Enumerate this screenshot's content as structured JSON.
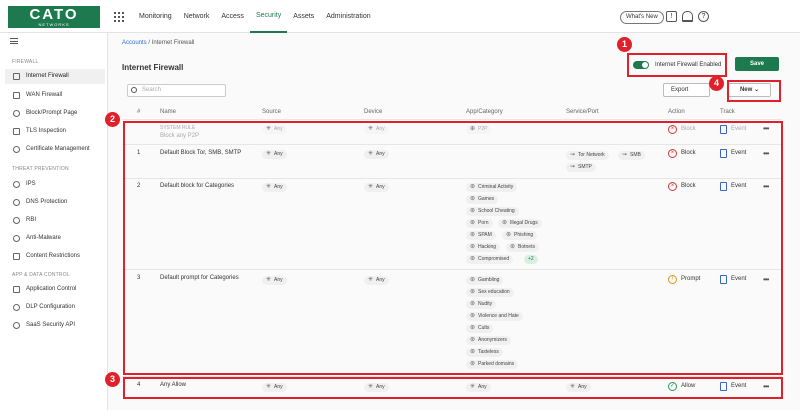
{
  "brand": {
    "name": "CATO",
    "sub": "NETWORKS"
  },
  "nav": [
    "Monitoring",
    "Network",
    "Access",
    "Security",
    "Assets",
    "Administration"
  ],
  "nav_active": "Security",
  "header": {
    "whats_new": "What's New"
  },
  "sidebar": {
    "sections": [
      {
        "label": "FIREWALL",
        "items": [
          "Internet Firewall",
          "WAN Firewall",
          "Block/Prompt Page",
          "TLS Inspection",
          "Certificate Management"
        ]
      },
      {
        "label": "THREAT PREVENTION",
        "items": [
          "IPS",
          "DNS Protection",
          "RBI",
          "Anti-Malware",
          "Content Restrictions"
        ]
      },
      {
        "label": "APP & DATA CONTROL",
        "items": [
          "Application Control",
          "DLP Configuration",
          "SaaS Security API"
        ]
      }
    ]
  },
  "breadcrumb": {
    "parent": "Accounts",
    "sep": "/",
    "current": "Internet Firewall"
  },
  "page_title": "Internet Firewall",
  "toggle_label": "Internet Firewall Enabled",
  "save_label": "Save",
  "search_placeholder": "Search",
  "export_label": "Export",
  "new_label": "New",
  "columns": [
    "#",
    "Name",
    "Source",
    "Device",
    "App/Category",
    "Service/Port",
    "Action",
    "Track"
  ],
  "rules": [
    {
      "num": "",
      "name": "SYSTEM RULE",
      "name2": "Block any P2P",
      "source": "Any",
      "device": "Any",
      "apps": [
        "P2P"
      ],
      "services": [],
      "action": "Block",
      "track": "Event"
    },
    {
      "num": "1",
      "name": "Default Block Tor, SMB, SMTP",
      "source": "Any",
      "device": "Any",
      "apps": [],
      "services": [
        "Tor Network",
        "SMB",
        "SMTP"
      ],
      "action": "Block",
      "track": "Event"
    },
    {
      "num": "2",
      "name": "Default block for Categories",
      "source": "Any",
      "device": "Any",
      "apps": [
        "Criminal Activity",
        "Games",
        "School Cheating",
        "Porn",
        "Illegal Drugs",
        "SPAM",
        "Phishing",
        "Hacking",
        "Botnets",
        "Compromised"
      ],
      "more": "+2",
      "services": [],
      "action": "Block",
      "track": "Event"
    },
    {
      "num": "3",
      "name": "Default prompt for Categories",
      "source": "Any",
      "device": "Any",
      "apps": [
        "Gambling",
        "Sex education",
        "Nudity",
        "Violence and Hate",
        "Cults",
        "Anonymizers",
        "Tasteless",
        "Parked domains"
      ],
      "services": [],
      "action": "Prompt",
      "track": "Event"
    },
    {
      "num": "4",
      "name": "Any Allow",
      "source": "Any",
      "device": "Any",
      "apps": [
        "Any"
      ],
      "services": [
        "Any"
      ],
      "action": "Allow",
      "track": "Event"
    }
  ],
  "annotations": [
    "1",
    "2",
    "3",
    "4"
  ],
  "colors": {
    "brand": "#1d7a4f",
    "annotation": "#e0202a",
    "link": "#2a6fd6"
  }
}
